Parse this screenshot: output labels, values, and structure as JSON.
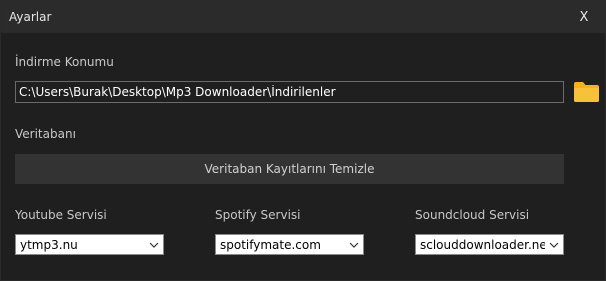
{
  "window": {
    "title": "Ayarlar",
    "close_label": "X"
  },
  "download_location": {
    "label": "İndirme Konumu",
    "path": "C:\\Users\\Burak\\Desktop\\Mp3 Downloader\\İndirilenler",
    "folder_icon": "folder-icon",
    "folder_color": "#f2b31b"
  },
  "database": {
    "label": "Veritabanı",
    "clear_button_label": "Veritaban Kayıtlarını Temizle"
  },
  "services": {
    "youtube": {
      "label": "Youtube Servisi",
      "selected": "ytmp3.nu"
    },
    "spotify": {
      "label": "Spotify Servisi",
      "selected": "spotifymate.com"
    },
    "soundcloud": {
      "label": "Soundcloud Servisi",
      "selected": "sclouddownloader.net"
    }
  }
}
